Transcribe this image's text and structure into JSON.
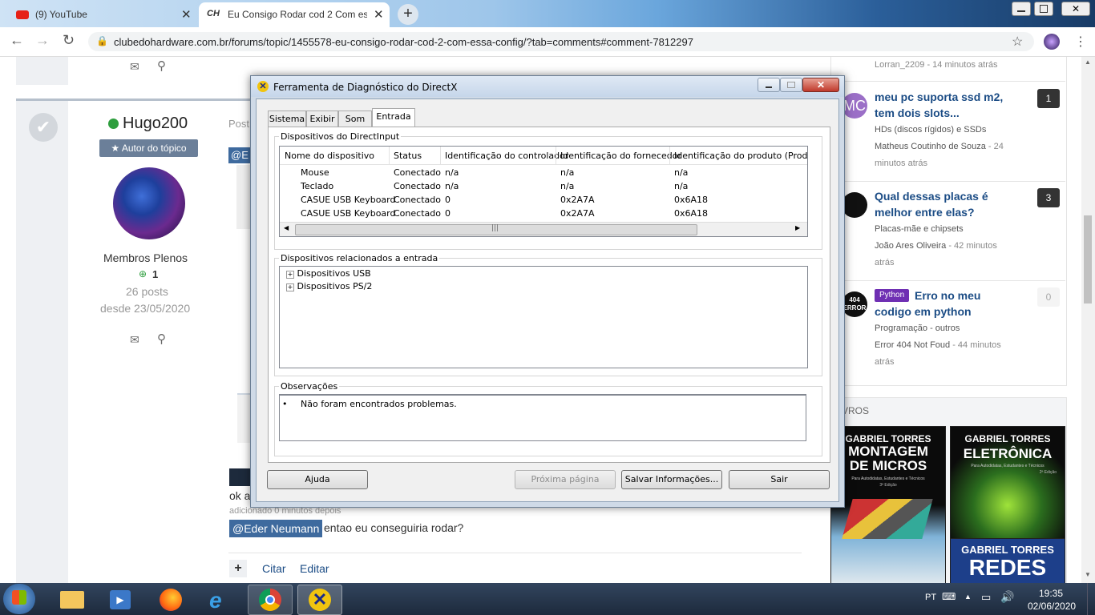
{
  "browser": {
    "tabs": [
      {
        "label": "(9) YouTube",
        "active": false
      },
      {
        "label": "Eu Consigo Rodar cod 2 Com ess",
        "active": true,
        "favicon_text": "CH"
      }
    ],
    "new_tab_label": "+",
    "url": "clubedohardware.com.br/forums/topic/1455578-eu-consigo-rodar-cod-2-com-essa-config/?tab=comments#comment-7812297",
    "window_controls": [
      "minimize",
      "maximize",
      "close"
    ]
  },
  "post": {
    "author": "Hugo200",
    "author_badge": "Autor do tópico",
    "rank": "Membros Plenos",
    "reputation": "1",
    "posts": "26 posts",
    "since": "desde 23/05/2020",
    "posted_prefix": "Post",
    "mention_partial": "@E",
    "fragment_ok": "ok a",
    "added_text": "adicionado 0 minutos depois",
    "mention": "@Eder Neumann",
    "reply_text": "entao eu conseguiria rodar?",
    "actions": {
      "plus": "+",
      "quote": "Citar",
      "edit": "Editar"
    }
  },
  "sidebar": {
    "top_meta": "Lorran_2209 - 14 minutos atrás",
    "items": [
      {
        "avatar": "MC",
        "title": "meu pc suporta ssd m2, tem dois slots...",
        "category": "HDs (discos rígidos) e SSDs",
        "meta_user": "Matheus Coutinho de Souza",
        "meta_time": " - 24 minutos atrás",
        "count": "1"
      },
      {
        "avatar": "",
        "title": "Qual dessas placas é melhor entre elas?",
        "category": "Placas-mãe e chipsets",
        "meta_user": "João Ares Oliveira",
        "meta_time": " - 42 minutos atrás",
        "count": "3"
      },
      {
        "avatar": "404 ERROR",
        "tag": "Python",
        "title": "Erro no meu codigo em python",
        "category": "Programação - outros",
        "meta_user": "Error 404 Not Foud",
        "meta_time": " - 44 minutos atrás",
        "count": "0"
      }
    ],
    "books_heading": "VROS",
    "books": [
      {
        "author": "GABRIEL TORRES",
        "title": "MONTAGEM DE MICROS",
        "subtitle": "Para Autodidatas, Estudantes e Técnicos",
        "edition": "3ª Edição"
      },
      {
        "author": "GABRIEL TORRES",
        "title": "ELETRÔNICA",
        "subtitle": "Para Autodidatas, Estudantes e Técnicos",
        "edition": "2ª Edição"
      },
      {
        "author": "GABRIEL TORRES",
        "title": "REDES"
      }
    ]
  },
  "dialog": {
    "title": "Ferramenta de Diagnóstico do DirectX",
    "tabs": [
      "Sistema",
      "Exibir",
      "Som",
      "Entrada"
    ],
    "active_tab": "Entrada",
    "group1_label": "Dispositivos do DirectInput",
    "columns": [
      "Nome do dispositivo",
      "Status",
      "Identificação do controlador",
      "Identificação do fornecedor",
      "Identificação do produto (Product I"
    ],
    "rows": [
      [
        "Mouse",
        "Conectado",
        "n/a",
        "n/a",
        "n/a"
      ],
      [
        "Teclado",
        "Conectado",
        "n/a",
        "n/a",
        "n/a"
      ],
      [
        "CASUE USB Keyboard",
        "Conectado",
        "0",
        "0x2A7A",
        "0x6A18"
      ],
      [
        "CASUE USB Keyboard",
        "Conectado",
        "0",
        "0x2A7A",
        "0x6A18"
      ]
    ],
    "group2_label": "Dispositivos relacionados a entrada",
    "tree": [
      "Dispositivos USB",
      "Dispositivos PS/2"
    ],
    "group3_label": "Observações",
    "notes": "Não foram encontrados problemas.",
    "buttons": {
      "help": "Ajuda",
      "next": "Próxima página",
      "save": "Salvar Informações...",
      "exit": "Sair"
    }
  },
  "taskbar": {
    "language": "PT",
    "time": "19:35",
    "date": "02/06/2020"
  },
  "colors": {
    "link_blue": "#1b4c85",
    "badge_grey": "#6b7f99",
    "mention_bg": "#3e6a9e",
    "python_tag": "#6f2fb3",
    "online": "#2e9e3e"
  }
}
